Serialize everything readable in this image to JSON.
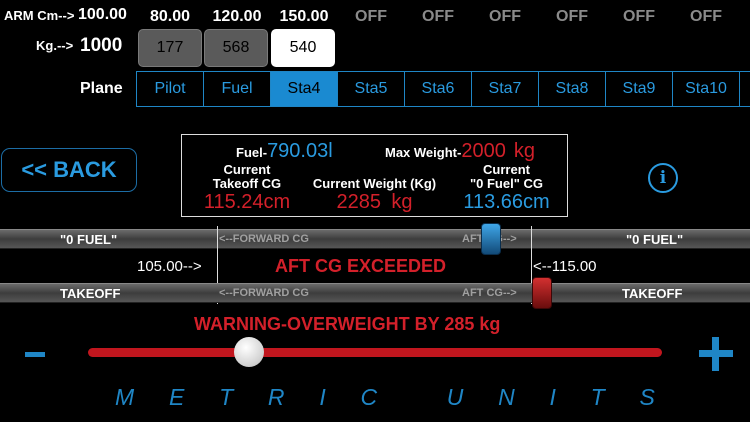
{
  "arm": {
    "label": "ARM Cm-->",
    "value": "100.00",
    "columns": [
      "80.00",
      "120.00",
      "150.00",
      "OFF",
      "OFF",
      "OFF",
      "OFF",
      "OFF",
      "OFF"
    ]
  },
  "kg": {
    "label": "Kg.-->",
    "value": "1000",
    "boxes": [
      "177",
      "568",
      "540"
    ]
  },
  "plane": {
    "label": "Plane",
    "tabs": [
      "Pilot",
      "Fuel",
      "Sta4",
      "Sta5",
      "Sta6",
      "Sta7",
      "Sta8",
      "Sta9",
      "Sta10"
    ],
    "active_tab": "Sta4"
  },
  "back_button": "<< BACK",
  "panel": {
    "fuel_label": "Fuel-",
    "fuel_value": "790.03l",
    "max_weight_label": "Max Weight-",
    "max_weight_value": "2000",
    "max_weight_unit": "kg",
    "takeoff_cg_label_1": "Current",
    "takeoff_cg_label_2": "Takeoff CG",
    "takeoff_cg_value": "115.24cm",
    "current_weight_label": "Current Weight (Kg)",
    "current_weight_value": "2285",
    "current_weight_unit": "kg",
    "zero_fuel_cg_label_1": "Current",
    "zero_fuel_cg_label_2": "\"0 Fuel\" CG",
    "zero_fuel_cg_value": "113.66cm"
  },
  "info_icon_glyph": "i",
  "zero_fuel_bar": {
    "left_label": "\"0 FUEL\"",
    "right_label": "\"0 FUEL\"",
    "forward_label": "<--FORWARD CG",
    "aft_label": "AFT CG-->"
  },
  "limits": {
    "forward": "105.00-->",
    "aft": "<--115.00"
  },
  "aft_cg_alert": "AFT CG EXCEEDED",
  "takeoff_bar": {
    "left_label": "TAKEOFF",
    "right_label": "TAKEOFF",
    "forward_label": "<--FORWARD CG",
    "aft_label": "AFT CG-->"
  },
  "overweight_warning": "WARNING-OVERWEIGHT BY 285 kg",
  "slider": {
    "minus": "-",
    "plus": "+"
  },
  "footer_words": [
    "M",
    "E",
    "T",
    "R",
    "I",
    "C",
    " ",
    "U",
    "N",
    "I",
    "T",
    "S"
  ],
  "colors": {
    "accent_blue": "#2a9be0",
    "alert_red": "#d3202a",
    "active_tab": "#1a8ad1"
  },
  "icons": [
    "info-icon",
    "minus-icon",
    "plus-icon"
  ]
}
